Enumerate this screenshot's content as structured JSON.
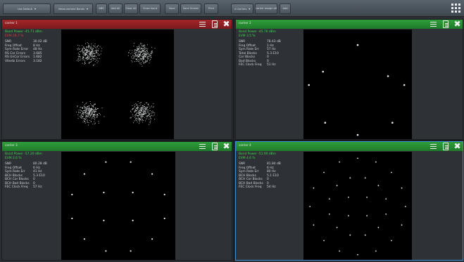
{
  "toolbar": {
    "buttons": [
      {
        "label": "Use Default",
        "dropdown": true
      },
      {
        "label": "Measurement Bands",
        "dropdown": true
      },
      {
        "label": "ABS",
        "dropdown": false
      },
      {
        "label": "Add All",
        "dropdown": false
      },
      {
        "label": "Clear All",
        "dropdown": false
      },
      {
        "label": "Close Input",
        "dropdown": false
      },
      {
        "label": "Save",
        "dropdown": false
      },
      {
        "label": "Save Screen",
        "dropdown": false
      },
      {
        "label": "Print",
        "dropdown": false
      },
      {
        "label": "4 Carriers",
        "dropdown": true
      },
      {
        "label": "carrier assign off",
        "dropdown": false
      },
      {
        "label": "Add",
        "dropdown": false
      }
    ]
  },
  "panels": [
    {
      "title": "carrier 1",
      "color": "red",
      "selected": false,
      "readout_top": [
        {
          "text": "Band Power  -45.71 dBm",
          "cls": "g"
        },
        {
          "text": "EVM          28.7   %",
          "cls": "r"
        }
      ],
      "rows": [
        {
          "label": "SNR",
          "value": "30.02 dB"
        },
        {
          "label": "Freq Offset",
          "value": "8    Hz"
        },
        {
          "label": "Sym Rate Error",
          "value": "48 Hz"
        },
        {
          "label": "RS Cor Errors",
          "value": "3.685"
        },
        {
          "label": "RS UnCor Errors",
          "value": "1.682"
        },
        {
          "label": "Viterbi Errors",
          "value": "3.182"
        }
      ]
    },
    {
      "title": "carrier 2",
      "color": "green",
      "selected": false,
      "readout_top": [
        {
          "text": "Band Power  -45.76 dBm",
          "cls": "g"
        },
        {
          "text": "EVM          3.5   %",
          "cls": "g"
        }
      ],
      "rows": [
        {
          "label": "SNR",
          "value": "78.43 dB"
        },
        {
          "label": "Freq Offset",
          "value": "1    Hz"
        },
        {
          "label": "Sym Rate Err",
          "value": "57   Hz"
        },
        {
          "label": "Total Blocks",
          "value": "5.3 E10"
        },
        {
          "label": "Cor Blocks",
          "value": "0"
        },
        {
          "label": "Bad Blocks",
          "value": "0"
        },
        {
          "label": "FEC Clock Freq",
          "value": "51 Hz"
        }
      ]
    },
    {
      "title": "carrier 3",
      "color": "green",
      "selected": false,
      "readout_top": [
        {
          "text": "Band Power  -57.20 dBm",
          "cls": "g"
        },
        {
          "text": "EVM          2.6   %",
          "cls": "g"
        }
      ],
      "rows": [
        {
          "label": "SNR",
          "value": "80.28 dB"
        },
        {
          "label": "Freq Offset",
          "value": "6    Hz"
        },
        {
          "label": "Sym Rate Err",
          "value": "41   Hz"
        },
        {
          "label": "BCH Blocks",
          "value": "5.3 E10"
        },
        {
          "label": "BCH Cor Blocks",
          "value": "0"
        },
        {
          "label": "BCH Bad Blocks",
          "value": "0"
        },
        {
          "label": "FEC Clock Freq",
          "value": "57 Hz"
        }
      ]
    },
    {
      "title": "carrier 4",
      "color": "green",
      "selected": true,
      "readout_top": [
        {
          "text": "Band Power  -51.90 dBm",
          "cls": "g"
        },
        {
          "text": "EVM          4.6   %",
          "cls": "g"
        }
      ],
      "rows": [
        {
          "label": "SNR",
          "value": "81.84 dB"
        },
        {
          "label": "Freq Offset",
          "value": "6    Hz"
        },
        {
          "label": "Sym Rate Err",
          "value": "80   Hz"
        },
        {
          "label": "BCH Blocks",
          "value": "5.1 E10"
        },
        {
          "label": "BCH Cor Blocks",
          "value": "0"
        },
        {
          "label": "BCH Bad Blocks",
          "value": "0"
        },
        {
          "label": "FEC Clock Freq",
          "value": "54 Hz"
        }
      ]
    }
  ],
  "icons": {
    "toolbar_right": "grid-menu-icon",
    "panel_buttons": [
      "settings-lines-icon",
      "document-icon",
      "close-icon"
    ]
  },
  "colors": {
    "accent_green": "#3fd64d",
    "accent_red": "#e03a3a",
    "title_red": "#a3262a",
    "title_green": "#2f9e3a",
    "selected_border": "#3a8ed6"
  },
  "constellations": [
    "qpsk-noisy",
    "qpsk-clean",
    "16apsk",
    "32apsk"
  ]
}
